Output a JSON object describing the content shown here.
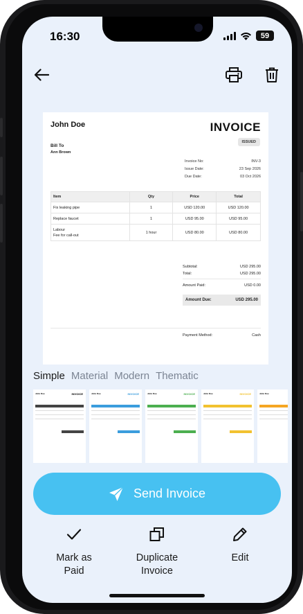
{
  "status_bar": {
    "time": "16:30",
    "battery": "59"
  },
  "invoice": {
    "from_name": "John Doe",
    "doc_title": "INVOICE",
    "status_badge": "ISSUED",
    "bill_to_label": "Bill To",
    "bill_to_name": "Ann Brown",
    "meta": [
      {
        "label": "Invoice No:",
        "value": "INV-3"
      },
      {
        "label": "Issue Date:",
        "value": "23 Sep 2026"
      },
      {
        "label": "Due Date:",
        "value": "03 Oct 2026"
      }
    ],
    "columns": [
      "Item",
      "Qty",
      "Price",
      "Total"
    ],
    "items": [
      {
        "item": "Fix leaking pipe",
        "note": "",
        "qty": "1",
        "price": "USD 120.00",
        "total": "USD 120.00"
      },
      {
        "item": "Replace faucet",
        "note": "",
        "qty": "1",
        "price": "USD 95.00",
        "total": "USD 95.00"
      },
      {
        "item": "Labour",
        "note": "Fee for call-out",
        "qty": "1 hour",
        "price": "USD 80.00",
        "total": "USD 80.00"
      }
    ],
    "subtotal_label": "Subtotal:",
    "subtotal": "USD 295.00",
    "total_label": "Total:",
    "total": "USD 295.00",
    "amount_paid_label": "Amount Paid:",
    "amount_paid": "USD 0.00",
    "amount_due_label": "Amount Due:",
    "amount_due": "USD 295.00",
    "payment_method_label": "Payment Method:",
    "payment_method": "Cash"
  },
  "templates": {
    "tabs": [
      "Simple",
      "Material",
      "Modern",
      "Thematic"
    ],
    "active_tab": "Simple",
    "thumbnails": [
      {
        "title": "INVOICE",
        "name": "John Doe",
        "color": "#444444"
      },
      {
        "title": "INVOICE",
        "name": "John Doe",
        "color": "#3b9ddd"
      },
      {
        "title": "INVOICE",
        "name": "John Doe",
        "color": "#4caf50"
      },
      {
        "title": "INVOICE",
        "name": "John Doe",
        "color": "#f2c230"
      },
      {
        "title": "",
        "name": "John Doe",
        "color": "#f5a623"
      }
    ]
  },
  "actions": {
    "send_label": "Send Invoice",
    "mark_paid_line1": "Mark as",
    "mark_paid_line2": "Paid",
    "duplicate_line1": "Duplicate",
    "duplicate_line2": "Invoice",
    "edit_label": "Edit"
  },
  "icons": {
    "back": "arrow-left-icon",
    "print": "printer-icon",
    "delete": "trash-icon",
    "send": "send-icon",
    "mark_paid": "check-icon",
    "duplicate": "copy-icon",
    "edit": "pencil-icon"
  },
  "colors": {
    "accent": "#47c1f1",
    "background": "#eaf1fb"
  }
}
